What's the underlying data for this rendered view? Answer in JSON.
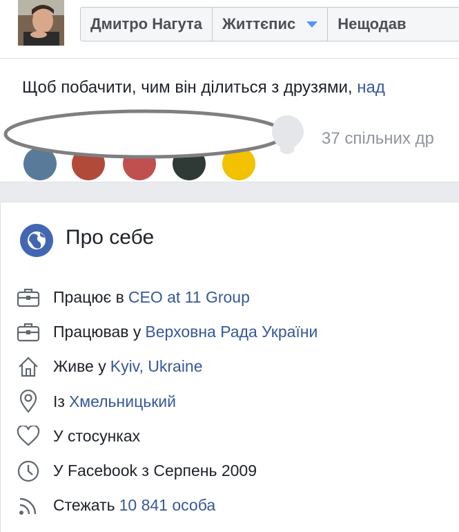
{
  "header": {
    "nav": [
      {
        "label": "Дмитро Нагута"
      },
      {
        "label": "Життєпис"
      },
      {
        "label": "Нещодав"
      }
    ]
  },
  "friends": {
    "prompt_text": "Щоб побачити, чим він ділиться з друзями,",
    "prompt_link": "над",
    "mutual_count": "37 спільних др"
  },
  "about": {
    "title": "Про себе",
    "items": [
      {
        "icon": "briefcase-icon",
        "prefix": "Працює в",
        "link": "CEO at 11 Group"
      },
      {
        "icon": "briefcase-icon",
        "prefix": "Працював у",
        "link": "Верховна Рада України"
      },
      {
        "icon": "home-icon",
        "prefix": "Живе у",
        "link": "Kyiv, Ukraine"
      },
      {
        "icon": "map-pin-icon",
        "prefix": "Із",
        "link": "Хмельницький"
      },
      {
        "icon": "heart-icon",
        "prefix": "У стосунках",
        "link": ""
      },
      {
        "icon": "clock-icon",
        "prefix": "У Facebook з Серпень 2009",
        "link": ""
      },
      {
        "icon": "rss-icon",
        "prefix": "Стежать",
        "link": "10 841 особа"
      }
    ]
  },
  "colors": {
    "link": "#365899",
    "accent": "#4267b2",
    "muted": "#90949c"
  }
}
